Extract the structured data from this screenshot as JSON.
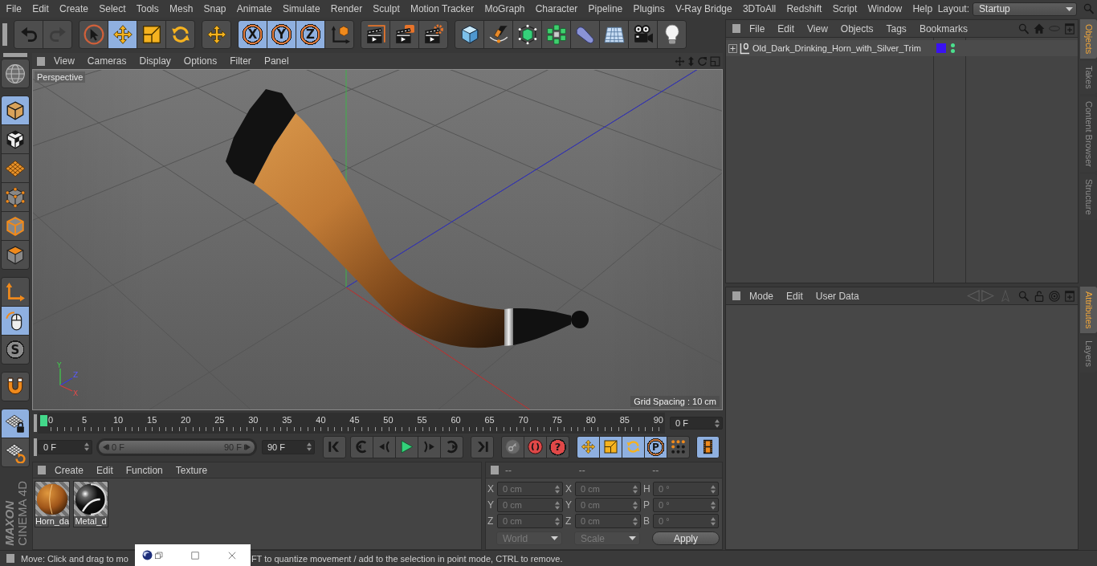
{
  "menu_bar": {
    "items": [
      "File",
      "Edit",
      "Create",
      "Select",
      "Tools",
      "Mesh",
      "Snap",
      "Animate",
      "Simulate",
      "Render",
      "Sculpt",
      "Motion Tracker",
      "MoGraph",
      "Character",
      "Pipeline",
      "Plugins",
      "V-Ray Bridge",
      "3DToAll",
      "Redshift",
      "Script",
      "Window",
      "Help"
    ],
    "layout_label": "Layout:",
    "layout_value": "Startup"
  },
  "toolbar": {
    "groups": [
      {
        "tools": [
          {
            "kind": "undo",
            "selected": false,
            "disabled": false
          },
          {
            "kind": "redo",
            "selected": false,
            "disabled": true
          }
        ]
      },
      {
        "tools": [
          {
            "kind": "live_selection",
            "selected": false
          },
          {
            "kind": "move",
            "selected": true
          },
          {
            "kind": "scale",
            "selected": false
          },
          {
            "kind": "rotate",
            "selected": false
          }
        ]
      },
      {
        "tools": [
          {
            "kind": "move",
            "selected": false
          }
        ]
      },
      {
        "tools": [
          {
            "kind": "axis",
            "label": "X",
            "selected": true
          },
          {
            "kind": "axis",
            "label": "Y",
            "selected": true
          },
          {
            "kind": "axis",
            "label": "Z",
            "selected": true
          },
          {
            "kind": "coordinate_system",
            "selected": false
          }
        ]
      },
      {
        "tools": [
          {
            "kind": "render_view",
            "selected": false
          },
          {
            "kind": "render_picture_viewer",
            "selected": false
          },
          {
            "kind": "render_settings",
            "selected": false
          }
        ]
      },
      {
        "tools": [
          {
            "kind": "cube",
            "selected": false
          },
          {
            "kind": "pen",
            "selected": false
          },
          {
            "kind": "subdivision",
            "selected": false
          },
          {
            "kind": "cloner",
            "selected": false
          },
          {
            "kind": "bend",
            "selected": false
          },
          {
            "kind": "floor",
            "selected": false
          },
          {
            "kind": "camera",
            "selected": false
          },
          {
            "kind": "light",
            "selected": false
          }
        ]
      }
    ]
  },
  "mode_palette": {
    "groups": [
      {
        "tools": [
          {
            "kind": "make_editable",
            "selected": false
          }
        ]
      },
      {
        "tools": [
          {
            "kind": "model",
            "selected": true
          },
          {
            "kind": "texture",
            "selected": false
          },
          {
            "kind": "workplane",
            "selected": false
          },
          {
            "kind": "points",
            "selected": false
          },
          {
            "kind": "edges",
            "selected": false
          },
          {
            "kind": "polygons",
            "selected": false
          }
        ]
      },
      {
        "tools": [
          {
            "kind": "axis_mode",
            "selected": false
          },
          {
            "kind": "tweak",
            "selected": true
          },
          {
            "kind": "solo",
            "label": "S",
            "selected": false
          }
        ]
      },
      {
        "tools": [
          {
            "kind": "snap",
            "selected": false
          }
        ]
      },
      {
        "tools": [
          {
            "kind": "lock_workplane",
            "selected": true
          },
          {
            "kind": "planar_workplane",
            "selected": false
          }
        ]
      }
    ],
    "logo": {
      "brand": "MAXON",
      "product": "CINEMA 4D"
    }
  },
  "viewport": {
    "menu": [
      "View",
      "Cameras",
      "Display",
      "Options",
      "Filter",
      "Panel"
    ],
    "camera": "Perspective",
    "grid_spacing": "Grid Spacing : 10 cm",
    "axis_labels": [
      "Y",
      "Z",
      "X"
    ]
  },
  "timeline": {
    "ticks": [
      "0",
      "5",
      "10",
      "15",
      "20",
      "25",
      "30",
      "35",
      "40",
      "45",
      "50",
      "55",
      "60",
      "65",
      "70",
      "75",
      "80",
      "85",
      "90"
    ],
    "level": 0,
    "current_frame": "0 F"
  },
  "transport": {
    "start_frame": "0 F",
    "preview_range": {
      "start": "0 F",
      "end": "90 F",
      "level": 1
    },
    "end_frame": "90 F",
    "groups": [
      {
        "buttons": [
          {
            "kind": "go_start"
          }
        ]
      },
      {
        "buttons": [
          {
            "kind": "previous_key"
          },
          {
            "kind": "previous_frame"
          },
          {
            "kind": "play"
          },
          {
            "kind": "next_frame"
          },
          {
            "kind": "next_key"
          }
        ]
      },
      {
        "buttons": [
          {
            "kind": "go_end"
          }
        ]
      },
      {
        "buttons": [
          {
            "kind": "key"
          },
          {
            "kind": "record"
          },
          {
            "kind": "keyframe_selection",
            "label": "?"
          }
        ]
      },
      {
        "buttons": [
          {
            "kind": "move",
            "selected": true
          },
          {
            "kind": "scale",
            "selected": true
          },
          {
            "kind": "rotate",
            "selected": true
          },
          {
            "kind": "parameter",
            "label": "P",
            "selected": true
          },
          {
            "kind": "point_level",
            "selected": false
          }
        ]
      },
      {
        "buttons": [
          {
            "kind": "timeline_window",
            "selected": true
          }
        ]
      }
    ]
  },
  "materials": {
    "menu": [
      "Create",
      "Edit",
      "Function",
      "Texture"
    ],
    "items": [
      {
        "name": "Horn_da",
        "kind": "horn"
      },
      {
        "name": "Metal_d",
        "kind": "metal"
      }
    ]
  },
  "coordinates": {
    "headers": [
      "--",
      "--",
      "--"
    ],
    "disabled": true,
    "columns": [
      {
        "fields": [
          {
            "axis": "X",
            "value": "0 cm"
          },
          {
            "axis": "Y",
            "value": "0 cm"
          },
          {
            "axis": "Z",
            "value": "0 cm"
          }
        ]
      },
      {
        "fields": [
          {
            "axis": "X",
            "value": "0 cm"
          },
          {
            "axis": "Y",
            "value": "0 cm"
          },
          {
            "axis": "Z",
            "value": "0 cm"
          }
        ]
      },
      {
        "fields": [
          {
            "axis": "H",
            "value": "0 °"
          },
          {
            "axis": "P",
            "value": "0 °"
          },
          {
            "axis": "B",
            "value": "0 °"
          }
        ]
      }
    ],
    "dropdowns": [
      "World",
      "Scale"
    ],
    "apply": "Apply"
  },
  "objects": {
    "menu": [
      "File",
      "Edit",
      "View",
      "Objects",
      "Tags",
      "Bookmarks"
    ],
    "rows": [
      {
        "name": "Old_Dark_Drinking_Horn_with_Silver_Trim",
        "expanded": false,
        "color": "#3a12f2",
        "editor_visible": true,
        "render_visible": true
      }
    ]
  },
  "attributes": {
    "menu": [
      "Mode",
      "Edit",
      "User Data"
    ]
  },
  "side_tabs": {
    "upper": [
      {
        "label": "Objects",
        "selected": true
      },
      {
        "label": "Takes",
        "selected": false
      },
      {
        "label": "Content Browser",
        "selected": false
      },
      {
        "label": "Structure",
        "selected": false
      }
    ],
    "lower": [
      {
        "label": "Attributes",
        "selected": true
      },
      {
        "label": "Layers",
        "selected": false
      }
    ]
  },
  "status_bar": {
    "text_before": "Move: Click and drag to mo",
    "text_after": "FT to quantize movement / add to the selection in point mode, CTRL to remove."
  }
}
